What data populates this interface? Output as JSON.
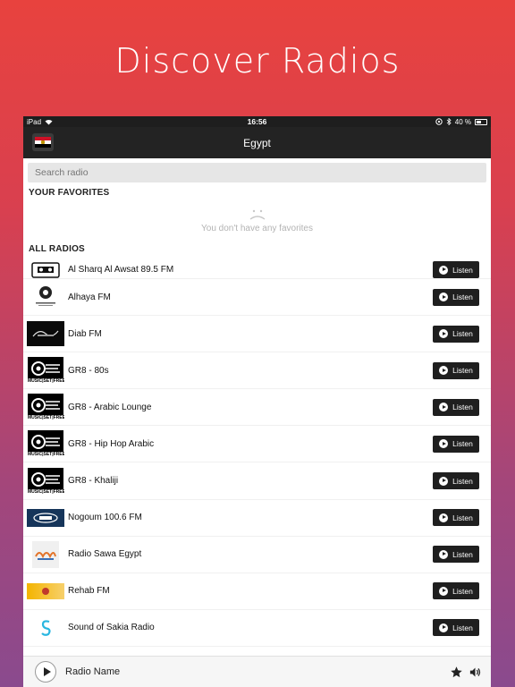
{
  "headline": "Discover Radios",
  "status_bar": {
    "device": "iPad",
    "time": "16:56",
    "battery": "40 %"
  },
  "nav": {
    "title": "Egypt"
  },
  "search": {
    "placeholder": "Search radio"
  },
  "favorites": {
    "title": "YOUR FAVORITES",
    "empty_message": "You don't have any favorites"
  },
  "all_radios": {
    "title": "ALL RADIOS",
    "listen_label": "Listen",
    "items": [
      {
        "name": "Al Sharq Al Awsat 89.5 FM",
        "logo": "radio-cassette-logo"
      },
      {
        "name": "Alhaya FM",
        "logo": "alhaya-logo"
      },
      {
        "name": "Diab FM",
        "logo": "diab-logo"
      },
      {
        "name": "GR8 - 80s",
        "logo": "gr8-logo"
      },
      {
        "name": "GR8 - Arabic Lounge",
        "logo": "gr8-logo"
      },
      {
        "name": "GR8 - Hip Hop Arabic",
        "logo": "gr8-logo"
      },
      {
        "name": "GR8 - Khaliji",
        "logo": "gr8-logo"
      },
      {
        "name": "Nogoum 100.6 FM",
        "logo": "nogoum-logo"
      },
      {
        "name": "Radio Sawa Egypt",
        "logo": "sawa-logo"
      },
      {
        "name": "Rehab FM",
        "logo": "rehab-logo"
      },
      {
        "name": "Sound of Sakia Radio",
        "logo": "sakia-logo"
      }
    ]
  },
  "gr8_logo_text": {
    "top": "gr8tunes",
    "sub": ".com",
    "bar": "MUSIC|SET|FREE"
  },
  "player": {
    "radio_name": "Radio Name"
  },
  "colors": {
    "nav_bg": "#232323",
    "button_bg": "#1f1f1f",
    "gradient_top": "#e8423e",
    "gradient_bottom": "#8a4a8e"
  }
}
